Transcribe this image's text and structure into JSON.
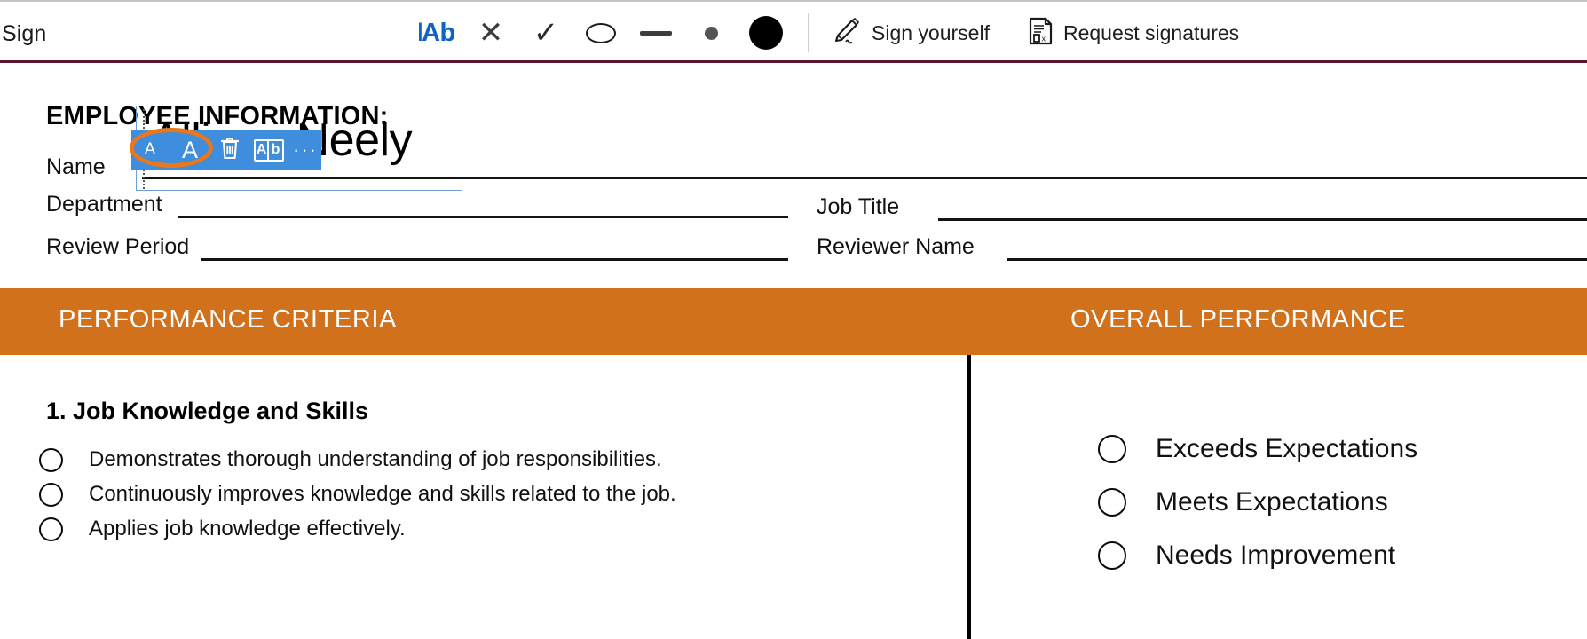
{
  "toolbar": {
    "title": "Sign",
    "tools": [
      {
        "name": "text-tool",
        "label": "IAb"
      },
      {
        "name": "cross-tool",
        "label": "✕"
      },
      {
        "name": "checkmark-tool",
        "label": "✓"
      },
      {
        "name": "oval-tool",
        "label": "oval"
      },
      {
        "name": "line-tool",
        "label": "line"
      },
      {
        "name": "small-dot-tool",
        "label": "small dot"
      },
      {
        "name": "large-dot-tool",
        "label": "large dot"
      }
    ],
    "sign_yourself_label": "Sign yourself",
    "request_signatures_label": "Request signatures"
  },
  "float_toolbar": {
    "font_small_label": "A",
    "font_large_label": "A",
    "delete_label": "delete",
    "rename_a_label": "A",
    "rename_b_label": "b",
    "more_label": "···"
  },
  "textbox": {
    "value": "Allison Neely"
  },
  "document": {
    "heading": "EMPLOYEE INFORMATION:",
    "fields": [
      {
        "label": "Name"
      },
      {
        "label": "Department"
      },
      {
        "label": "Job Title"
      },
      {
        "label": "Review Period"
      },
      {
        "label": "Reviewer Name"
      }
    ],
    "banner_left": "PERFORMANCE CRITERIA",
    "banner_right": "OVERALL PERFORMANCE",
    "criteria_title": "1. Job Knowledge and Skills",
    "criteria_items": [
      "Demonstrates thorough understanding of job responsibilities.",
      "Continuously improves knowledge and skills related to the job.",
      "Applies job knowledge effectively."
    ],
    "rating_options": [
      "Exceeds Expectations",
      "Meets Expectations",
      "Needs Improvement"
    ]
  },
  "colors": {
    "banner_orange": "#d2711b",
    "annotation_orange": "#e8771e",
    "toolbar_blue": "#3f8ddd",
    "accent_blue": "#1062c4",
    "maroon_rule": "#5a1430"
  }
}
